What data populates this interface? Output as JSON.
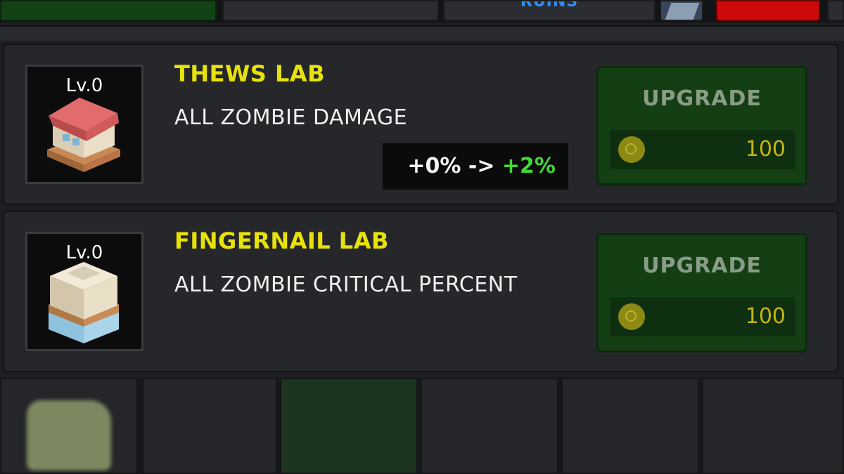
{
  "topbar": {
    "tab_ruins": "RUINS"
  },
  "labs": [
    {
      "level": "Lv.0",
      "title": "THEWS LAB",
      "description": "ALL ZOMBIE DAMAGE",
      "stat_current": "+0% -> ",
      "stat_next": "+2%",
      "upgrade_label": "UPGRADE",
      "cost": "100",
      "building_icon": "red-roof-house-icon"
    },
    {
      "level": "Lv.0",
      "title": "FINGERNAIL LAB",
      "description": "ALL ZOMBIE CRITICAL PERCENT",
      "upgrade_label": "UPGRADE",
      "cost": "100",
      "building_icon": "tall-building-icon"
    }
  ],
  "colors": {
    "title_yellow": "#e7e20a",
    "stat_green": "#43d63a",
    "button_green": "#143f15",
    "ruins_blue": "#2f8fff"
  }
}
